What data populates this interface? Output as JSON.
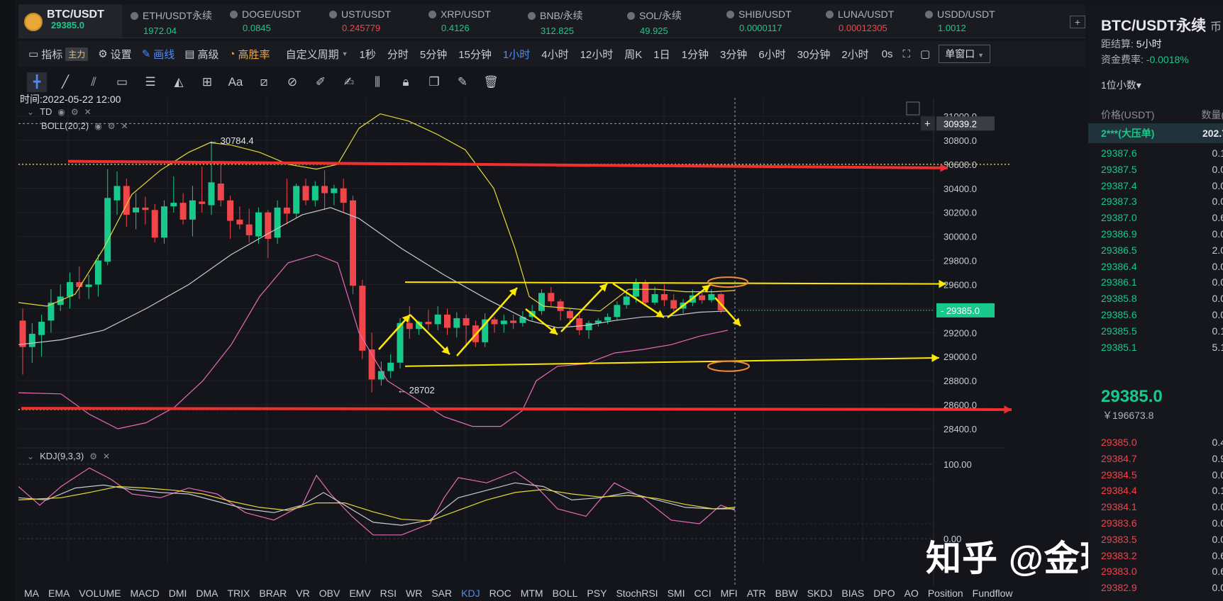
{
  "tabs": [
    {
      "name": "BTC/USDT",
      "price": "29385.0",
      "color": "green",
      "active": true
    },
    {
      "name": "ETH/USDT永续",
      "price": "1972.04",
      "color": "green"
    },
    {
      "name": "DOGE/USDT",
      "price": "0.0845",
      "color": "green"
    },
    {
      "name": "UST/USDT",
      "price": "0.245779",
      "color": "red"
    },
    {
      "name": "XRP/USDT",
      "price": "0.4126",
      "color": "green"
    },
    {
      "name": "BNB/永续",
      "price": "312.825",
      "color": "green"
    },
    {
      "name": "SOL/永续",
      "price": "49.925",
      "color": "green"
    },
    {
      "name": "SHIB/USDT",
      "price": "0.0000117",
      "color": "green"
    },
    {
      "name": "LUNA/USDT",
      "price": "0.00012305",
      "color": "red"
    },
    {
      "name": "USDD/USDT",
      "price": "1.0012",
      "color": "green"
    }
  ],
  "tab_add": "+",
  "toolbar": {
    "indicator": "指标",
    "main_badge": "主力",
    "settings": "设置",
    "draw": "画线",
    "advanced": "高级",
    "win_rate": "高胜率",
    "custom_period": "自定义周期",
    "periods": [
      "1秒",
      "分时",
      "5分钟",
      "15分钟",
      "1小时",
      "4小时",
      "12小时",
      "周K",
      "1日",
      "1分钟",
      "3分钟",
      "6小时",
      "30分钟",
      "2小时"
    ],
    "active_period": "1小时",
    "countdown": "0s",
    "window": "单窗口"
  },
  "chart": {
    "time_label": "时间:2022-05-22 12:00",
    "td_label": "TD",
    "boll_label": "BOLL(20,2)",
    "high_label": "← 30784.4",
    "low_label": "← 28702",
    "crosshair_price": "30939.2",
    "current_price_tag": "29385.0",
    "price_ticks": [
      "31000.0",
      "30800.0",
      "30600.0",
      "30400.0",
      "30200.0",
      "30000.0",
      "29800.0",
      "29600.0",
      "29400.0",
      "29200.0",
      "29000.0",
      "28800.0",
      "28600.0",
      "28400.0"
    ],
    "kdj_label": "KDJ(9,3,3)",
    "kdj_ticks": [
      "100.00",
      "0.00"
    ],
    "colors": {
      "up": "#17c98a",
      "down": "#f0454a",
      "annot_yellow": "#ffe800",
      "annot_red": "#f03030",
      "annot_orange": "#f08a3a",
      "boll_up": "#e8d83a",
      "boll_mid": "#c8cad0",
      "boll_low": "#e86ab8"
    }
  },
  "indicators": [
    "MA",
    "EMA",
    "VOLUME",
    "MACD",
    "DMI",
    "DMA",
    "TRIX",
    "BRAR",
    "VR",
    "OBV",
    "EMV",
    "RSI",
    "WR",
    "SAR",
    "KDJ",
    "ROC",
    "MTM",
    "BOLL",
    "PSY",
    "StochRSI",
    "SMI",
    "CCI",
    "MFI",
    "ATR",
    "BBW",
    "SKDJ",
    "BIAS",
    "DPO",
    "AO",
    "Position",
    "Fundflow"
  ],
  "active_indicator": "KDJ",
  "watermark": "知乎 @金玲谈币",
  "side": {
    "title": "BTC/USDT永续",
    "title_suffix": "币",
    "settle_label": "距结算:",
    "settle_value": "5小时",
    "funding_label": "资金费率:",
    "funding_value": "-0.0018%",
    "decimals": "1位小数▾",
    "col_price": "价格(USDT)",
    "col_qty": "数量(BT",
    "big_order_label": "2***(大压单)",
    "big_order_value": "202.7",
    "asks": [
      {
        "p": "29387.6",
        "q": "0.1"
      },
      {
        "p": "29387.5",
        "q": "0.0"
      },
      {
        "p": "29387.4",
        "q": "0.0"
      },
      {
        "p": "29387.3",
        "q": "0.0"
      },
      {
        "p": "29387.0",
        "q": "0.6"
      },
      {
        "p": "29386.9",
        "q": "0.0"
      },
      {
        "p": "29386.5",
        "q": "2.0"
      },
      {
        "p": "29386.4",
        "q": "0.0"
      },
      {
        "p": "29386.1",
        "q": "0.0"
      },
      {
        "p": "29385.8",
        "q": "0.0"
      },
      {
        "p": "29385.6",
        "q": "0.0"
      },
      {
        "p": "29385.5",
        "q": "0.1"
      },
      {
        "p": "29385.1",
        "q": "5.1"
      }
    ],
    "last_price": "29385.0",
    "last_fiat": "￥196673.8",
    "bids": [
      {
        "p": "29385.0",
        "q": "0.4"
      },
      {
        "p": "29384.7",
        "q": "0.9"
      },
      {
        "p": "29384.5",
        "q": "0.0"
      },
      {
        "p": "29384.4",
        "q": "0.1"
      },
      {
        "p": "29384.1",
        "q": "0.0"
      },
      {
        "p": "29383.6",
        "q": "0.0"
      },
      {
        "p": "29383.5",
        "q": "0.0"
      },
      {
        "p": "29383.2",
        "q": "0.6"
      },
      {
        "p": "29383.0",
        "q": "0.6"
      },
      {
        "p": "29382.9",
        "q": "0.0"
      }
    ]
  }
}
